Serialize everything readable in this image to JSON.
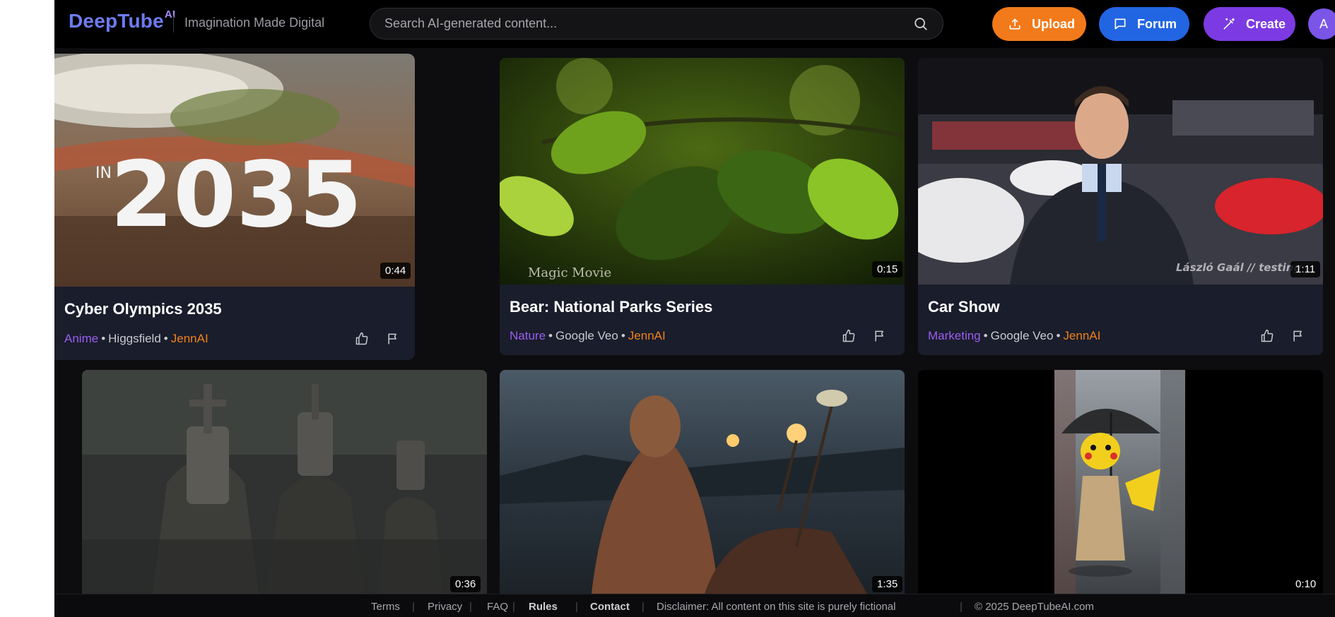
{
  "header": {
    "logo": "DeepTube",
    "logo_sup": "AI",
    "tagline": "Imagination Made Digital",
    "search_placeholder": "Search AI-generated content...",
    "upload_label": "Upload",
    "forum_label": "Forum",
    "create_label": "Create",
    "avatar_initial": "A"
  },
  "videos": [
    {
      "title": "Cyber Olympics 2035",
      "category": "Anime",
      "model": "Higgsfield",
      "author": "JennAI",
      "duration": "0:44",
      "overlay_text": "2035",
      "overlay_small": "IN"
    },
    {
      "title": "Bear: National Parks Series",
      "category": "Nature",
      "model": "Google Veo",
      "author": "JennAI",
      "duration": "0:15",
      "watermark": "Magic Movie"
    },
    {
      "title": "Car Show",
      "category": "Marketing",
      "model": "Google Veo",
      "author": "JennAI",
      "duration": "1:11",
      "watermark": "László Gaál // testing"
    },
    {
      "duration": "0:36"
    },
    {
      "duration": "1:35"
    },
    {
      "duration": "0:10"
    }
  ],
  "footer": {
    "terms": "Terms",
    "privacy": "Privacy",
    "faq": "FAQ",
    "rules": "Rules",
    "contact": "Contact",
    "disclaimer": "Disclaimer: All content on this site is purely fictional",
    "copyright": "© 2025 DeepTubeAI.com"
  },
  "colors": {
    "upload": "#f27a1a",
    "forum": "#2165e3",
    "create": "#7c3ae2",
    "category": "#9a5ef0",
    "author": "#f0821c"
  }
}
